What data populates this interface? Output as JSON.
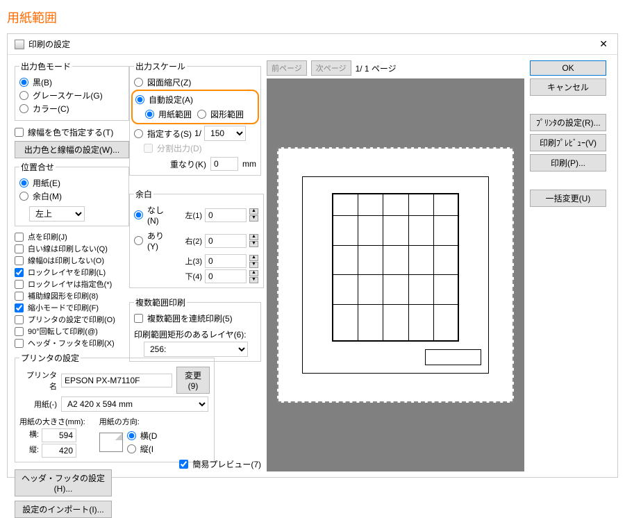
{
  "page_title": "用紙範囲",
  "titlebar": {
    "title": "印刷の設定",
    "close": "✕"
  },
  "output_color": {
    "legend": "出力色モード",
    "black": "黒(B)",
    "grayscale": "グレースケール(G)",
    "color": "カラー(C)"
  },
  "line_width_by_color": "線幅を色で指定する(T)",
  "color_width_settings_btn": "出力色と線幅の設定(W)...",
  "position": {
    "legend": "位置合せ",
    "paper": "用紙(E)",
    "margin": "余白(M)",
    "anchor_select": "左上"
  },
  "checklist": {
    "items": [
      {
        "label": "点を印刷(J)",
        "checked": false
      },
      {
        "label": "白い線は印刷しない(Q)",
        "checked": false
      },
      {
        "label": "線幅0は印刷しない(O)",
        "checked": false
      },
      {
        "label": "ロックレイヤを印刷(L)",
        "checked": true
      },
      {
        "label": "ロックレイヤは指定色(*)",
        "checked": false
      },
      {
        "label": "補助線図形を印刷(8)",
        "checked": false
      },
      {
        "label": "縮小モードで印刷(F)",
        "checked": true
      },
      {
        "label": "プリンタの設定で印刷(O)",
        "checked": false
      },
      {
        "label": "90°回転して印刷(@)",
        "checked": false
      },
      {
        "label": "ヘッダ・フッタを印刷(X)",
        "checked": false
      }
    ]
  },
  "output_scale": {
    "legend": "出力スケール",
    "drawing_scale": "図面縮尺(Z)",
    "auto": "自動設定(A)",
    "paper_range": "用紙範囲",
    "shape_range": "図形範囲",
    "specify": "指定する(S)",
    "scale_prefix": "1/",
    "scale_value": "150",
    "split_output": "分割出力(D)",
    "overlap_label": "重なり(K)",
    "overlap_value": "0",
    "overlap_unit": "mm"
  },
  "margin": {
    "legend": "余白",
    "none": "なし(N)",
    "yes": "あり(Y)",
    "left_label": "左(1)",
    "right_label": "右(2)",
    "top_label": "上(3)",
    "bottom_label": "下(4)",
    "left": "0",
    "right": "0",
    "top": "0",
    "bottom": "0"
  },
  "multi_range": {
    "legend": "複数範囲印刷",
    "continuous": "複数範囲を連続印刷(5)",
    "layer_label": "印刷範囲矩形のあるレイヤ(6):",
    "layer_value": "256:"
  },
  "printer": {
    "legend": "プリンタの設定",
    "name_label": "プリンタ名",
    "name_value": "EPSON PX-M7110F",
    "change_btn": "変更(9)",
    "paper_label": "用紙(-)",
    "paper_value": "A2 420 x 594 mm",
    "size_label": "用紙の大きさ(mm):",
    "orient_label": "用紙の方向:",
    "width_label": "横:",
    "height_label": "縦:",
    "width_value": "594",
    "height_value": "420",
    "landscape": "横(D",
    "portrait": "縦(I"
  },
  "header_footer_btn": "ヘッダ・フッタの設定(H)...",
  "import_btn": "設定のインポート(I)...",
  "simple_preview": "簡易プレビュー(7)",
  "pager": {
    "prev": "前ページ",
    "next": "次ページ",
    "current": "1/ 1 ページ"
  },
  "right_buttons": {
    "ok": "OK",
    "cancel": "キャンセル",
    "printer_settings": "ﾌﾟﾘﾝﾀの設定(R)...",
    "print_preview": "印刷ﾌﾟﾚﾋﾞｭｰ(V)",
    "print": "印刷(P)...",
    "batch_change": "一括変更(U)"
  }
}
